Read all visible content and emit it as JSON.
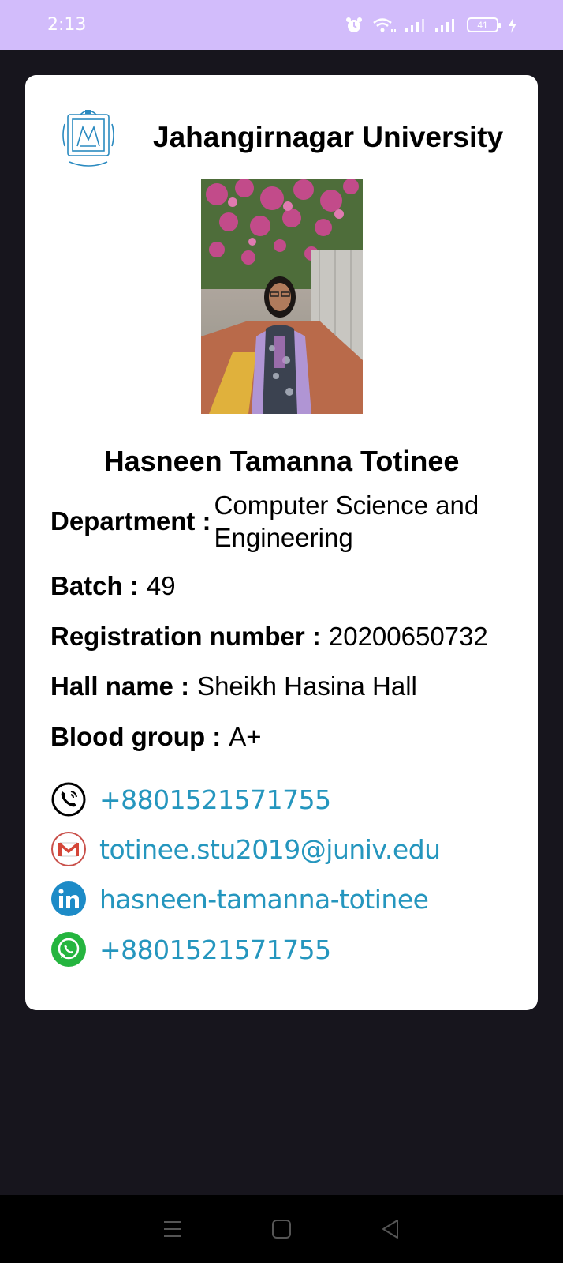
{
  "status_bar": {
    "time": "2:13",
    "battery": "41"
  },
  "card": {
    "university": "Jahangirnagar University",
    "student_name": "Hasneen Tamanna Totinee",
    "fields": [
      {
        "label": "Department :",
        "value": "Computer Science and Engineering"
      },
      {
        "label": "Batch :",
        "value": "49"
      },
      {
        "label": "Registration number :",
        "value": "20200650732"
      },
      {
        "label": "Hall name :",
        "value": "Sheikh Hasina Hall"
      },
      {
        "label": "Blood group :",
        "value": "A+"
      }
    ],
    "contacts": [
      {
        "icon": "phone-icon",
        "text": "+8801521571755"
      },
      {
        "icon": "gmail-icon",
        "text": "totinee.stu2019@juniv.edu"
      },
      {
        "icon": "linkedin-icon",
        "text": "hasneen-tamanna-totinee"
      },
      {
        "icon": "whatsapp-icon",
        "text": "+8801521571755"
      }
    ]
  },
  "colors": {
    "status_bar": "#d2bcfb",
    "background": "#17151d",
    "link": "#2596be",
    "linkedin": "#1d8bc7",
    "whatsapp": "#25b53f",
    "gmail": "#d44638"
  }
}
